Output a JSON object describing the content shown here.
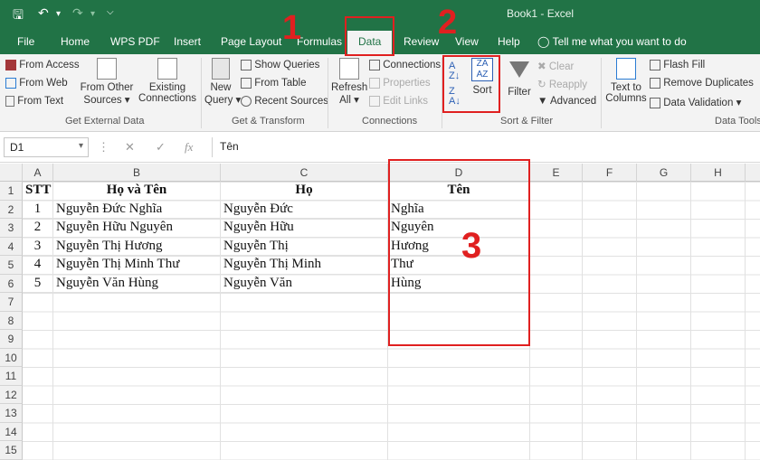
{
  "app": {
    "title": "Book1  -  Excel"
  },
  "tabs": [
    "File",
    "Home",
    "WPS PDF",
    "Insert",
    "Page Layout",
    "Formulas",
    "Data",
    "Review",
    "View",
    "Help"
  ],
  "tell_me": "Tell me what you want to do",
  "ribbon": {
    "get_external_data": {
      "from_access": "From Access",
      "from_web": "From Web",
      "from_text": "From Text",
      "from_other": "From Other",
      "sources": "Sources",
      "existing": "Existing",
      "connections": "Connections",
      "group": "Get External Data"
    },
    "get_transform": {
      "new": "New",
      "query": "Query",
      "show_queries": "Show Queries",
      "from_table": "From Table",
      "recent_sources": "Recent Sources",
      "group": "Get & Transform"
    },
    "connections": {
      "refresh": "Refresh",
      "all": "All",
      "connections": "Connections",
      "properties": "Properties",
      "edit_links": "Edit Links",
      "group": "Connections"
    },
    "sort_filter": {
      "sort": "Sort",
      "filter": "Filter",
      "clear": "Clear",
      "reapply": "Reapply",
      "advanced": "Advanced",
      "group": "Sort & Filter"
    },
    "data_tools": {
      "text_to": "Text to",
      "columns": "Columns",
      "flash_fill": "Flash Fill",
      "remove_duplicates": "Remove Duplicates",
      "data_validation": "Data Validation",
      "group": "Data Tools"
    }
  },
  "formula_bar": {
    "name_box": "D1",
    "content": "Tên"
  },
  "columns": [
    "A",
    "B",
    "C",
    "D",
    "E",
    "F",
    "G",
    "H"
  ],
  "rows": [
    "1",
    "2",
    "3",
    "4",
    "5",
    "6",
    "7",
    "8",
    "9",
    "10",
    "11",
    "12",
    "13",
    "14",
    "15"
  ],
  "table": {
    "headers": [
      "STT",
      "Họ và Tên",
      "Họ",
      "Tên"
    ],
    "rows": [
      [
        "1",
        "Nguyễn Đức Nghĩa",
        "Nguyễn Đức",
        "Nghĩa"
      ],
      [
        "2",
        "Nguyễn Hữu Nguyên",
        "Nguyễn Hữu",
        "Nguyên"
      ],
      [
        "3",
        "Nguyễn Thị Hương",
        "Nguyễn Thị",
        "Hương"
      ],
      [
        "4",
        "Nguyễn Thị Minh Thư",
        "Nguyễn Thị Minh",
        "Thư"
      ],
      [
        "5",
        "Nguyễn Văn Hùng",
        "Nguyễn Văn",
        "Hùng"
      ]
    ]
  },
  "annotations": {
    "step1": "1",
    "step2": "2",
    "step3": "3"
  },
  "colors": {
    "excel_green": "#217346",
    "annotation_red": "#e02020"
  }
}
